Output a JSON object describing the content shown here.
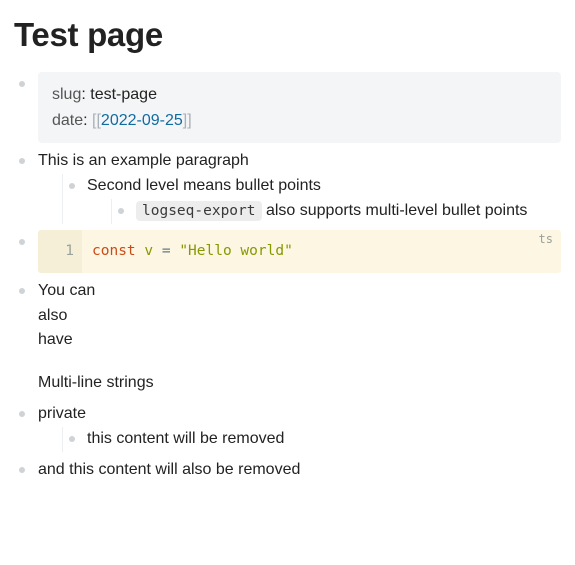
{
  "title": "Test page",
  "props": {
    "slug_key": "slug",
    "slug_value": "test-page",
    "date_key": "date",
    "date_value": "2022-09-25"
  },
  "b1": {
    "text": "This is an example paragraph",
    "child": {
      "text": "Second level means bullet points",
      "child": {
        "code": "logseq-export",
        "rest": " also supports multi-level bullet points"
      }
    }
  },
  "code": {
    "lang": "ts",
    "lineno": "1",
    "kw": "const",
    "var": "v",
    "op": "=",
    "str": "\"Hello world\""
  },
  "multi": {
    "lines": "You can\nalso\nhave",
    "tail": "Multi-line strings"
  },
  "priv": {
    "text": "private",
    "child": "this content will be removed"
  },
  "last": "and this content will also be removed"
}
